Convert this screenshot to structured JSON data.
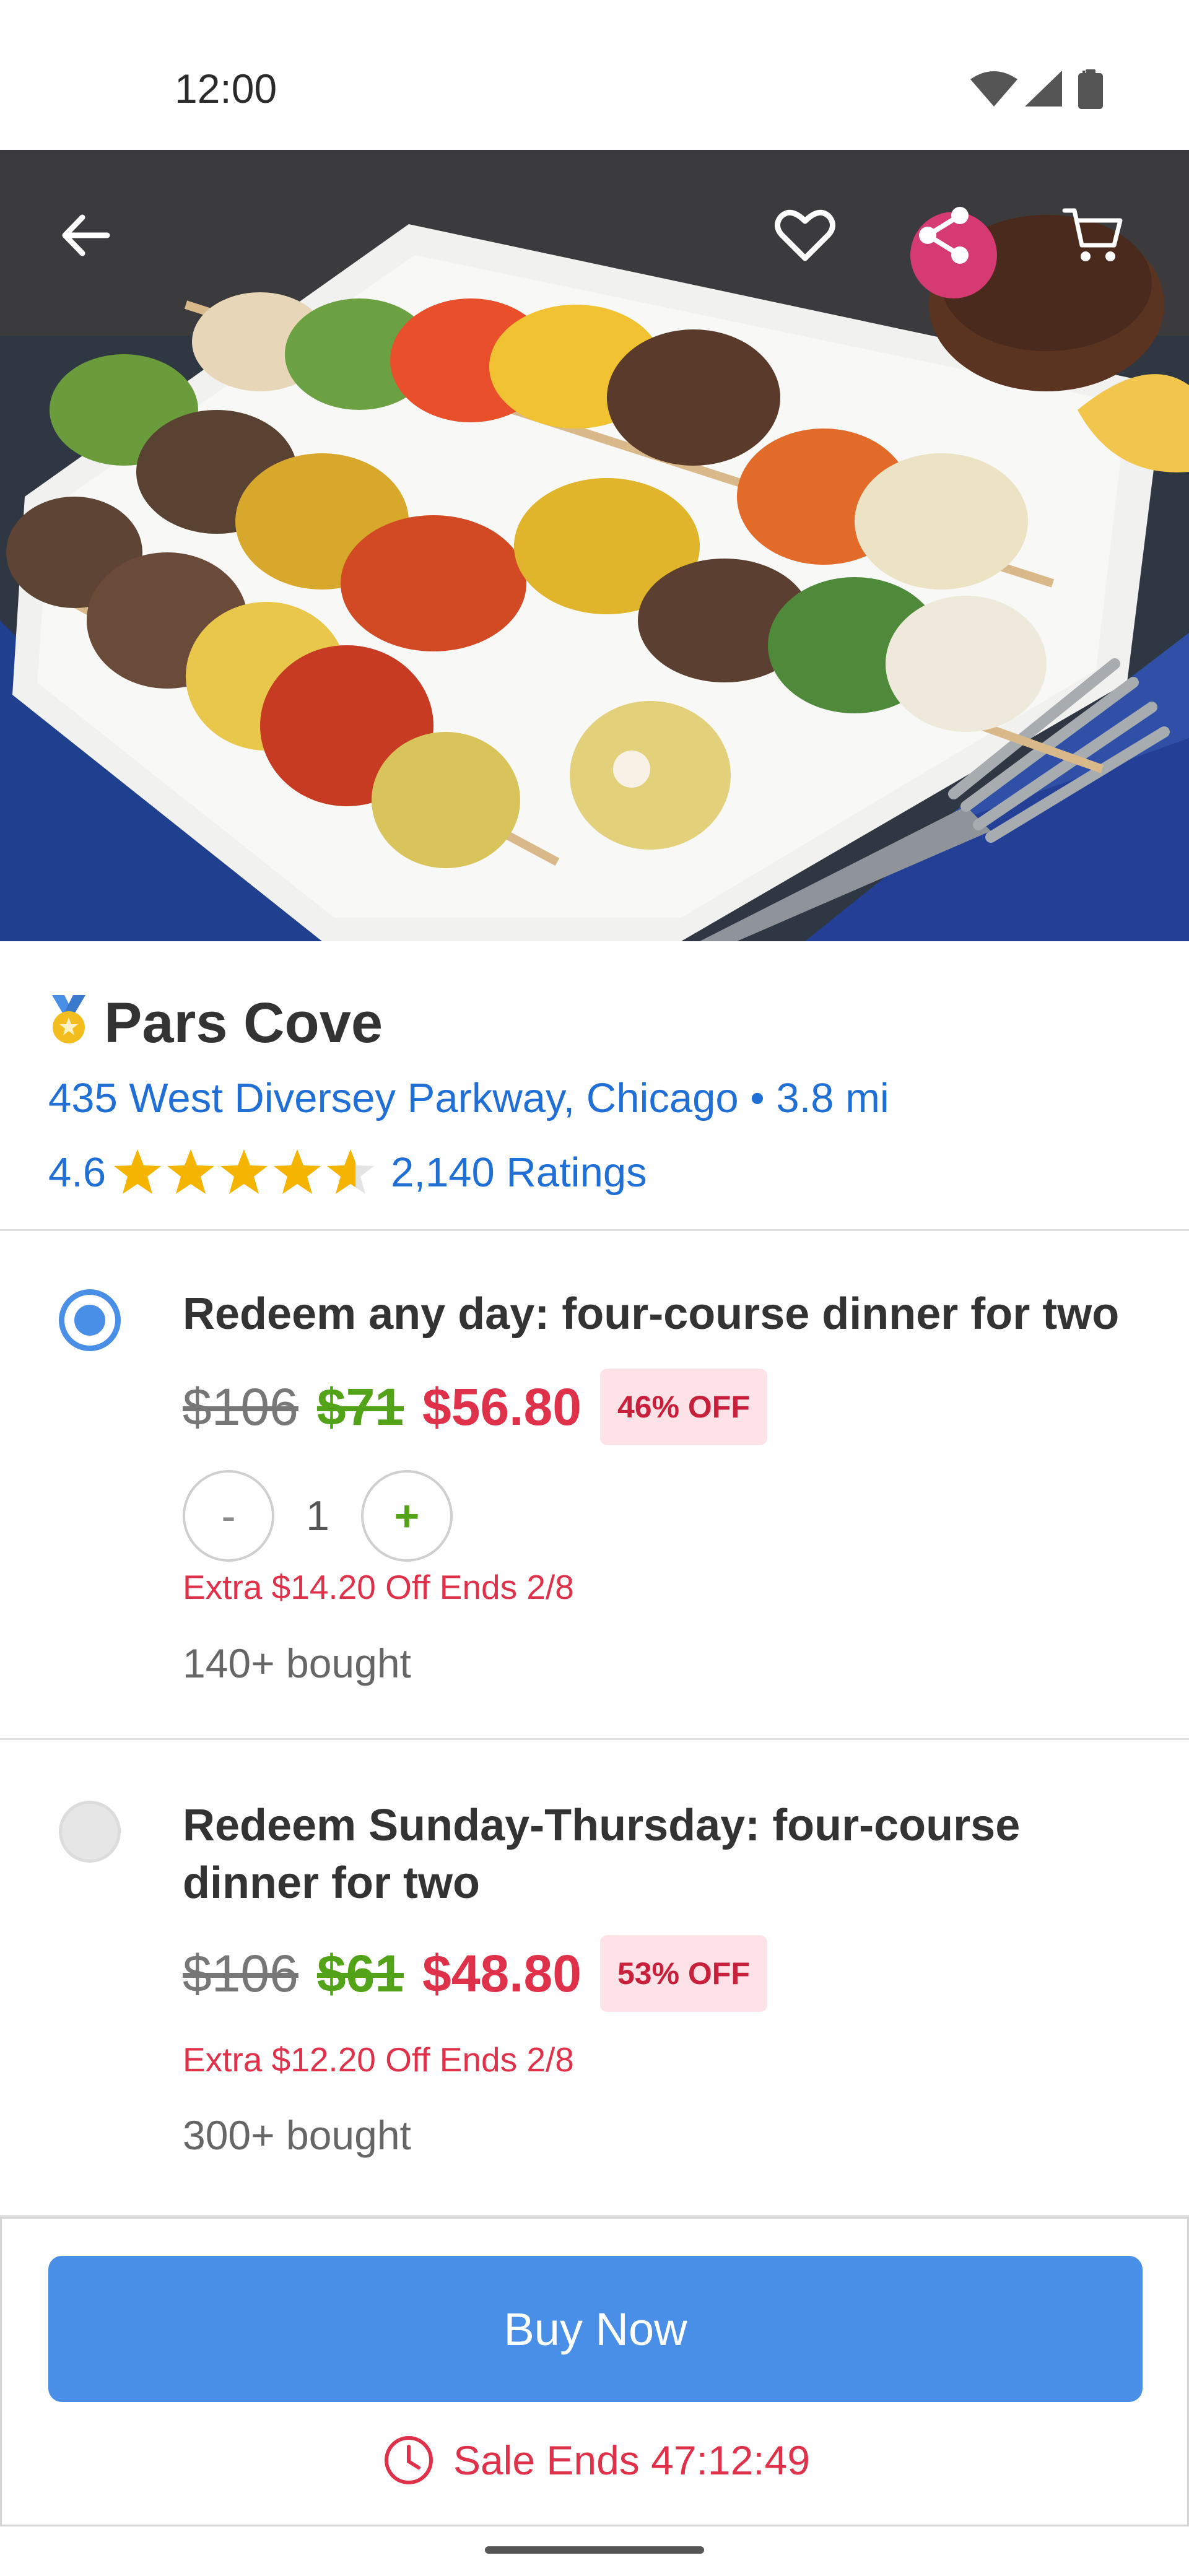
{
  "status_bar": {
    "time": "12:00",
    "icons": [
      "wifi-icon",
      "signal-icon",
      "battery-icon"
    ]
  },
  "hero": {
    "image": "grilled-vegetable-skewers-photo",
    "actions": [
      "back-arrow-icon",
      "heart-icon",
      "share-icon",
      "cart-icon"
    ]
  },
  "merchant": {
    "badge_icon": "medal-icon",
    "name": "Pars Cove",
    "address": "435 West Diversey Parkway, Chicago • 3.8 mi",
    "rating": "4.6",
    "rating_value": 4.6,
    "ratings_count": "2,140 Ratings"
  },
  "options": [
    {
      "selected": true,
      "title": "Redeem any day: four-course dinner for two",
      "original_price": "$106",
      "deal_price": "$71",
      "sale_price": "$56.80",
      "discount": "46% OFF",
      "quantity": "1",
      "minus_label": "-",
      "plus_label": "+",
      "extra": "Extra $14.20 Off Ends 2/8",
      "bought": "140+ bought"
    },
    {
      "selected": false,
      "title": "Redeem Sunday-Thursday: four-course dinner for two",
      "original_price": "$106",
      "deal_price": "$61",
      "sale_price": "$48.80",
      "discount": "53% OFF",
      "extra": "Extra $12.20 Off Ends 2/8",
      "bought": "300+ bought"
    }
  ],
  "footer": {
    "buy_label": "Buy Now",
    "sale_ends": "Sale Ends 47:12:49",
    "clock_icon": "clock-icon"
  },
  "colors": {
    "accent_blue": "#4a8fe7",
    "link_blue": "#1f6fd6",
    "sale_red": "#e0314b",
    "deal_green": "#53a318",
    "star_gold": "#f5b400"
  }
}
